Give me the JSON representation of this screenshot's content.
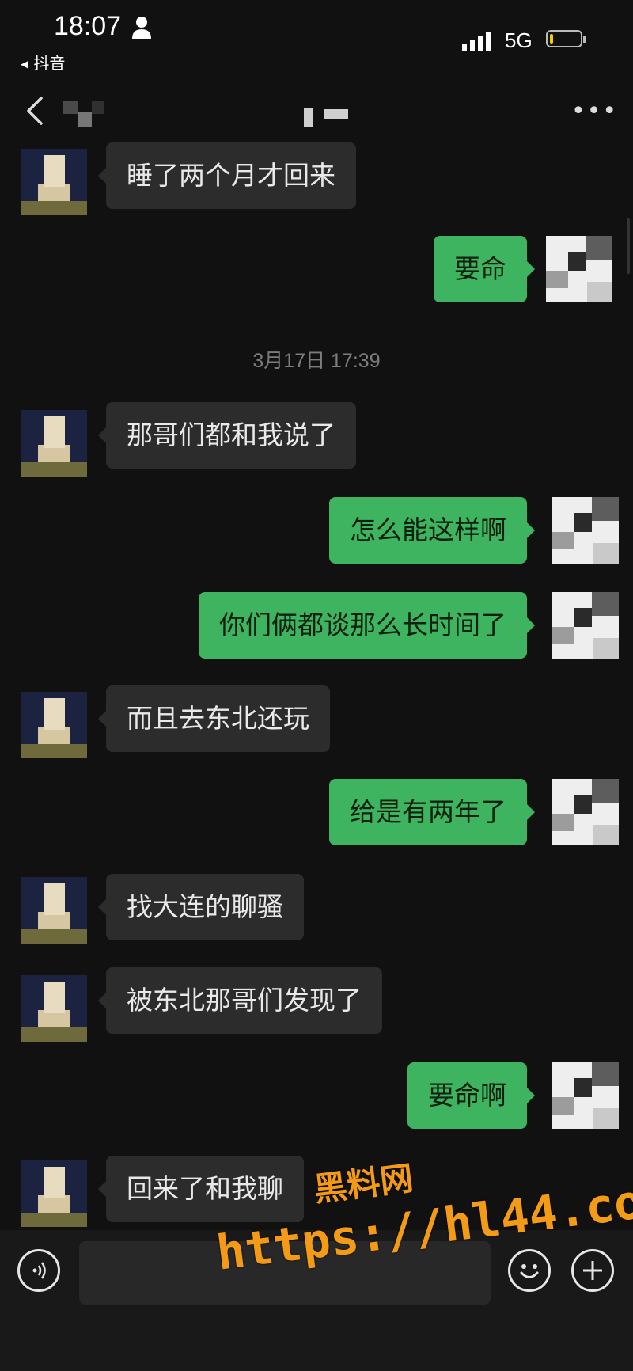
{
  "status_bar": {
    "time": "18:07",
    "back_app": "◂ 抖音",
    "network": "5G",
    "battery_level": 0.12,
    "battery_color": "#f5d000"
  },
  "nav": {
    "back_icon": "chevron-left-icon",
    "more_icon": "more-dots-icon",
    "more_glyph": "•••"
  },
  "timestamp": "3月17日 17:39",
  "messages": [
    {
      "side": "in",
      "text": "睡了两个月才回来"
    },
    {
      "side": "out",
      "text": "要命"
    },
    {
      "side": "in",
      "text": "那哥们都和我说了"
    },
    {
      "side": "out",
      "text": "怎么能这样啊"
    },
    {
      "side": "out",
      "text": "你们俩都谈那么长时间了"
    },
    {
      "side": "in",
      "text": "而且去东北还玩"
    },
    {
      "side": "out",
      "text": "给是有两年了"
    },
    {
      "side": "in",
      "text": "找大连的聊骚"
    },
    {
      "side": "in",
      "text": "被东北那哥们发现了"
    },
    {
      "side": "out",
      "text": "要命啊"
    },
    {
      "side": "in",
      "text": "回来了和我聊"
    }
  ],
  "input_bar": {
    "voice_icon": "voice-icon",
    "emoji_icon": "emoji-icon",
    "plus_icon": "plus-icon",
    "text_value": ""
  },
  "watermark": {
    "line1": "黑料网",
    "line2": "https://hl44.co"
  },
  "colors": {
    "background": "#111111",
    "incoming_bubble": "#2c2c2c",
    "outgoing_bubble": "#3eb360",
    "watermark": "#f39a16"
  }
}
